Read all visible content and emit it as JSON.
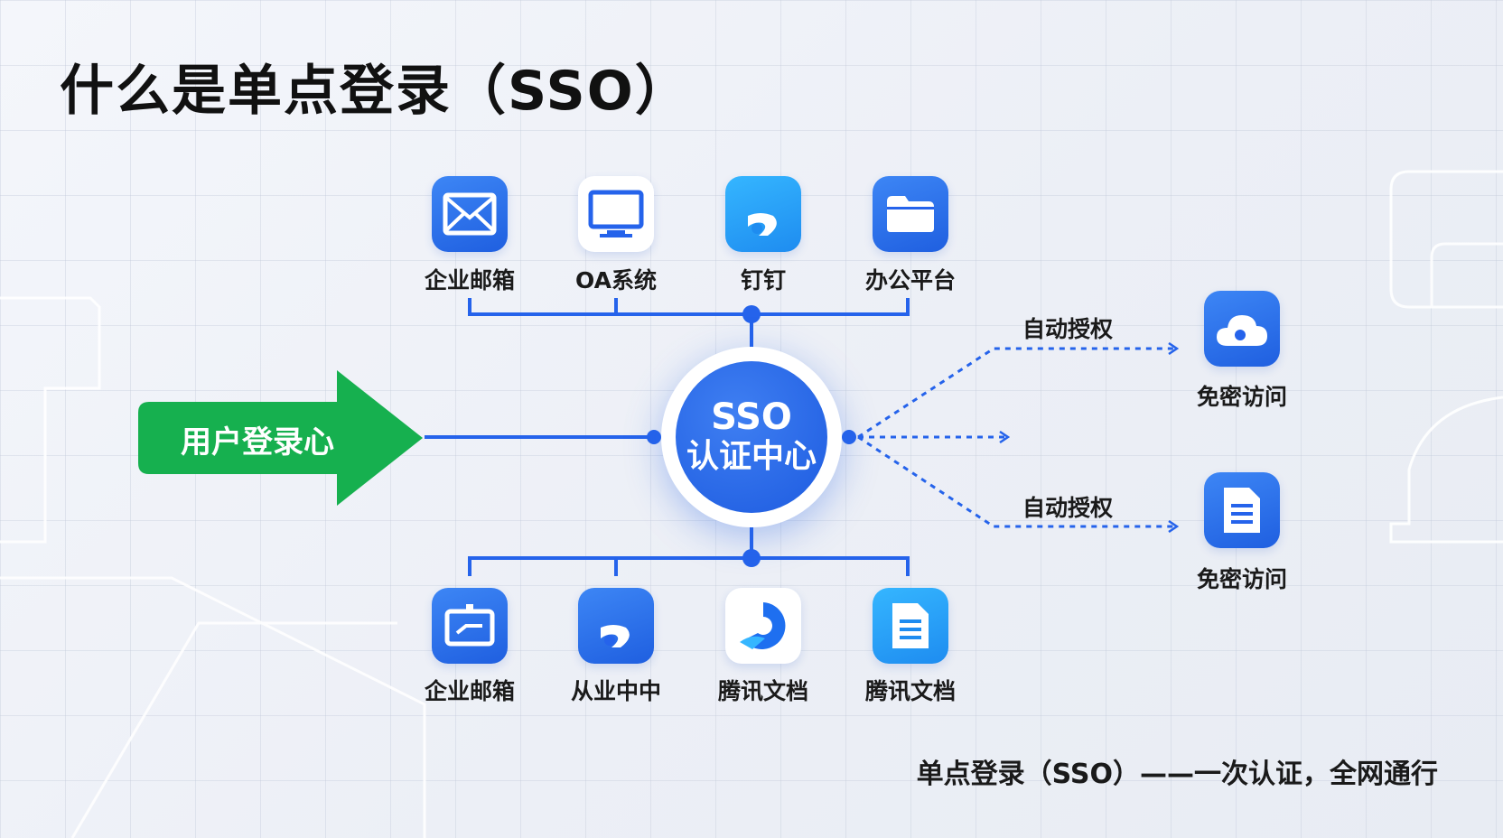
{
  "title": "什么是单点登录（SSO）",
  "hub": {
    "line1": "SSO",
    "line2": "认证中心"
  },
  "user_entry": "用户登录心",
  "top_apps": [
    {
      "label": "企业邮箱",
      "icon": "mail-icon"
    },
    {
      "label": "OA系统",
      "icon": "monitor-icon"
    },
    {
      "label": "钉钉",
      "icon": "dingtalk-icon"
    },
    {
      "label": "办公平台",
      "icon": "folder-icon"
    }
  ],
  "bottom_apps": [
    {
      "label": "企业邮箱",
      "icon": "board-icon"
    },
    {
      "label": "从业中中",
      "icon": "dingtalk-icon"
    },
    {
      "label": "腾讯文档",
      "icon": "tencent-docs-icon"
    },
    {
      "label": "腾讯文档",
      "icon": "document-icon"
    }
  ],
  "right_targets": [
    {
      "auth_label": "自动授权",
      "access_label": "免密访问",
      "icon": "cloud-icon"
    },
    {
      "auth_label": "自动授权",
      "access_label": "免密访问",
      "icon": "document-icon"
    }
  ],
  "footer": "单点登录（SSO）——一次认证，全网通行",
  "colors": {
    "primary_blue": "#2563eb",
    "sky_blue": "#1e8cf0",
    "green": "#16b04f",
    "text": "#111111"
  }
}
